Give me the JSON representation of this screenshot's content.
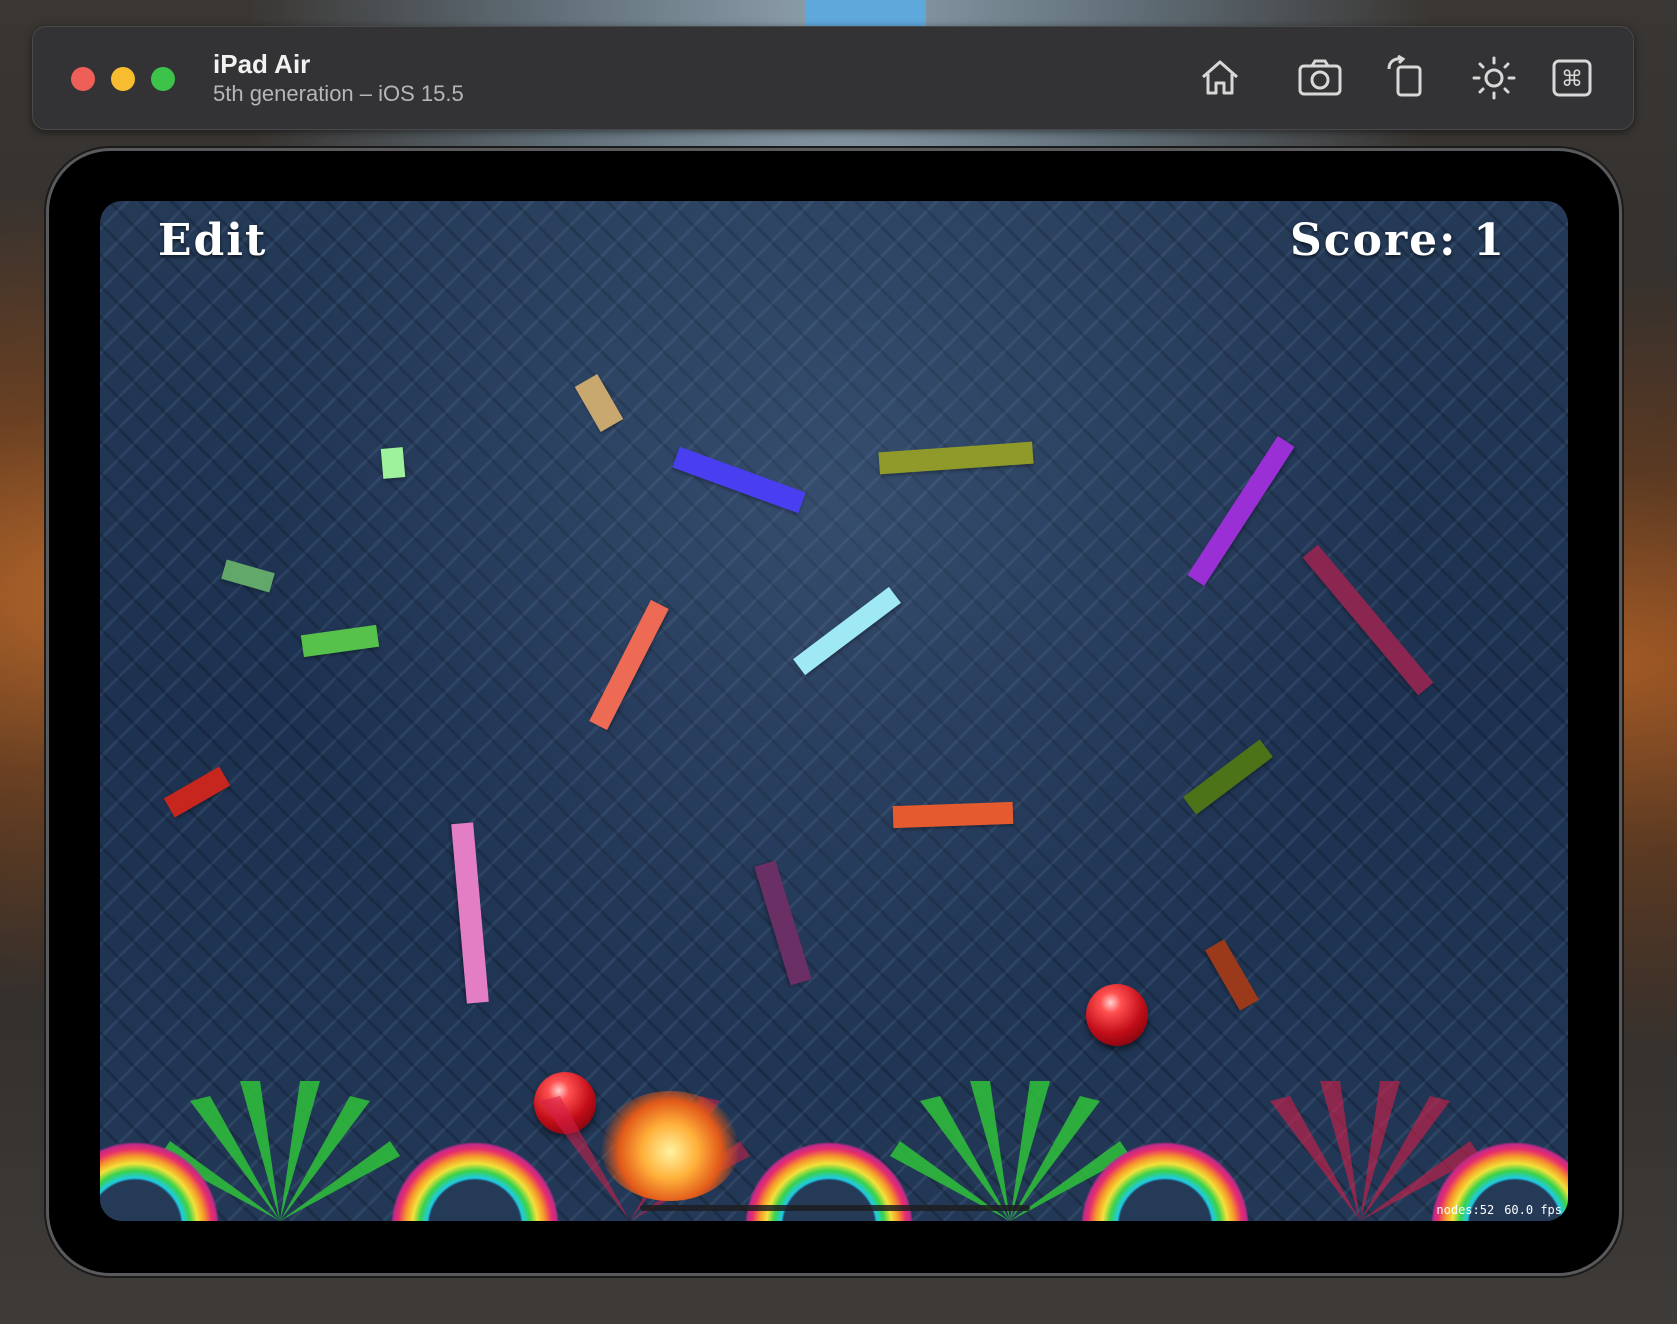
{
  "window": {
    "device_name": "iPad Air",
    "device_subtitle": "5th generation – iOS 15.5",
    "toolbar_icons": [
      "home-icon",
      "screenshot-camera-icon",
      "rotate-icon",
      "appearance-sun-icon",
      "command-key-icon"
    ]
  },
  "game": {
    "edit_label": "Edit",
    "score_label": "Score:",
    "score_value": "1",
    "stats": {
      "nodes": "nodes:52",
      "fps": "60.0 fps"
    },
    "bar_colors": [
      "#c9a86f",
      "#9ef29c",
      "#4a3ff0",
      "#8f9a2a",
      "#9b2fd6",
      "#62a86a",
      "#56c24c",
      "#ed6a54",
      "#9fe9f5",
      "#8a2650",
      "#c7261f",
      "#e37dc4",
      "#6a3065",
      "#e55a2f",
      "#4d7318",
      "#9a3a1a"
    ],
    "ball_color": "#d8121e"
  }
}
